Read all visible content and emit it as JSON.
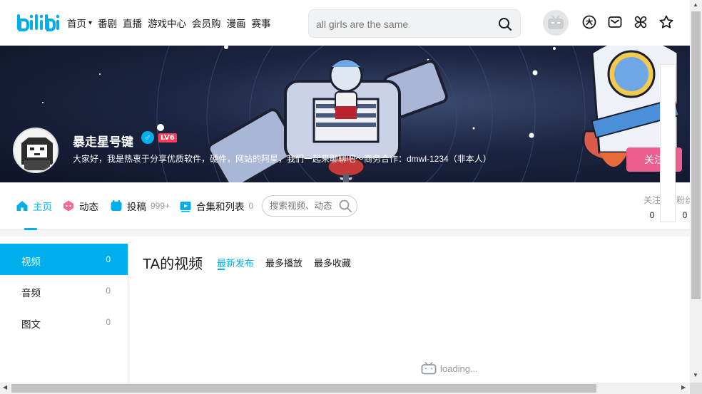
{
  "header": {
    "logo": "bilibili",
    "nav": [
      {
        "label": "首页",
        "has_dropdown": true
      },
      {
        "label": "番剧"
      },
      {
        "label": "直播"
      },
      {
        "label": "游戏中心"
      },
      {
        "label": "会员购"
      },
      {
        "label": "漫画"
      },
      {
        "label": "赛事"
      }
    ],
    "search_placeholder": "all girls are the same",
    "icons": [
      "avatar-icon",
      "big-member-icon",
      "message-icon",
      "dynamic-icon",
      "favorite-icon"
    ]
  },
  "banner": {
    "username": "暴走星号键",
    "gender_symbol": "♂",
    "level": "LV6",
    "sign": "大家好，我是热衷于分享优质软件，硬件，网站的阿星，我们一起来聊聊吧～商务合作：dmwl-1234（非本人）",
    "follow_label": "关注"
  },
  "tabs": {
    "items": [
      {
        "label": "主页",
        "count": "",
        "active": true
      },
      {
        "label": "动态",
        "count": ""
      },
      {
        "label": "投稿",
        "count": "999+"
      },
      {
        "label": "合集和列表",
        "count": "0"
      }
    ],
    "search_placeholder": "搜索视频、动态",
    "stats": [
      {
        "label": "关注",
        "value": "0"
      },
      {
        "label": "粉丝",
        "value": "0"
      }
    ]
  },
  "sidebar": {
    "items": [
      {
        "label": "视频",
        "count": "0",
        "active": true
      },
      {
        "label": "音频",
        "count": "0"
      },
      {
        "label": "图文",
        "count": "0"
      }
    ]
  },
  "main": {
    "title": "TA的视频",
    "orders": [
      {
        "label": "最新发布",
        "active": true
      },
      {
        "label": "最多播放"
      },
      {
        "label": "最多收藏"
      }
    ],
    "loading_text": "loading..."
  },
  "colors": {
    "accent": "#00aeec",
    "follow": "#ec5e8e",
    "level": "#fb3c5a"
  }
}
